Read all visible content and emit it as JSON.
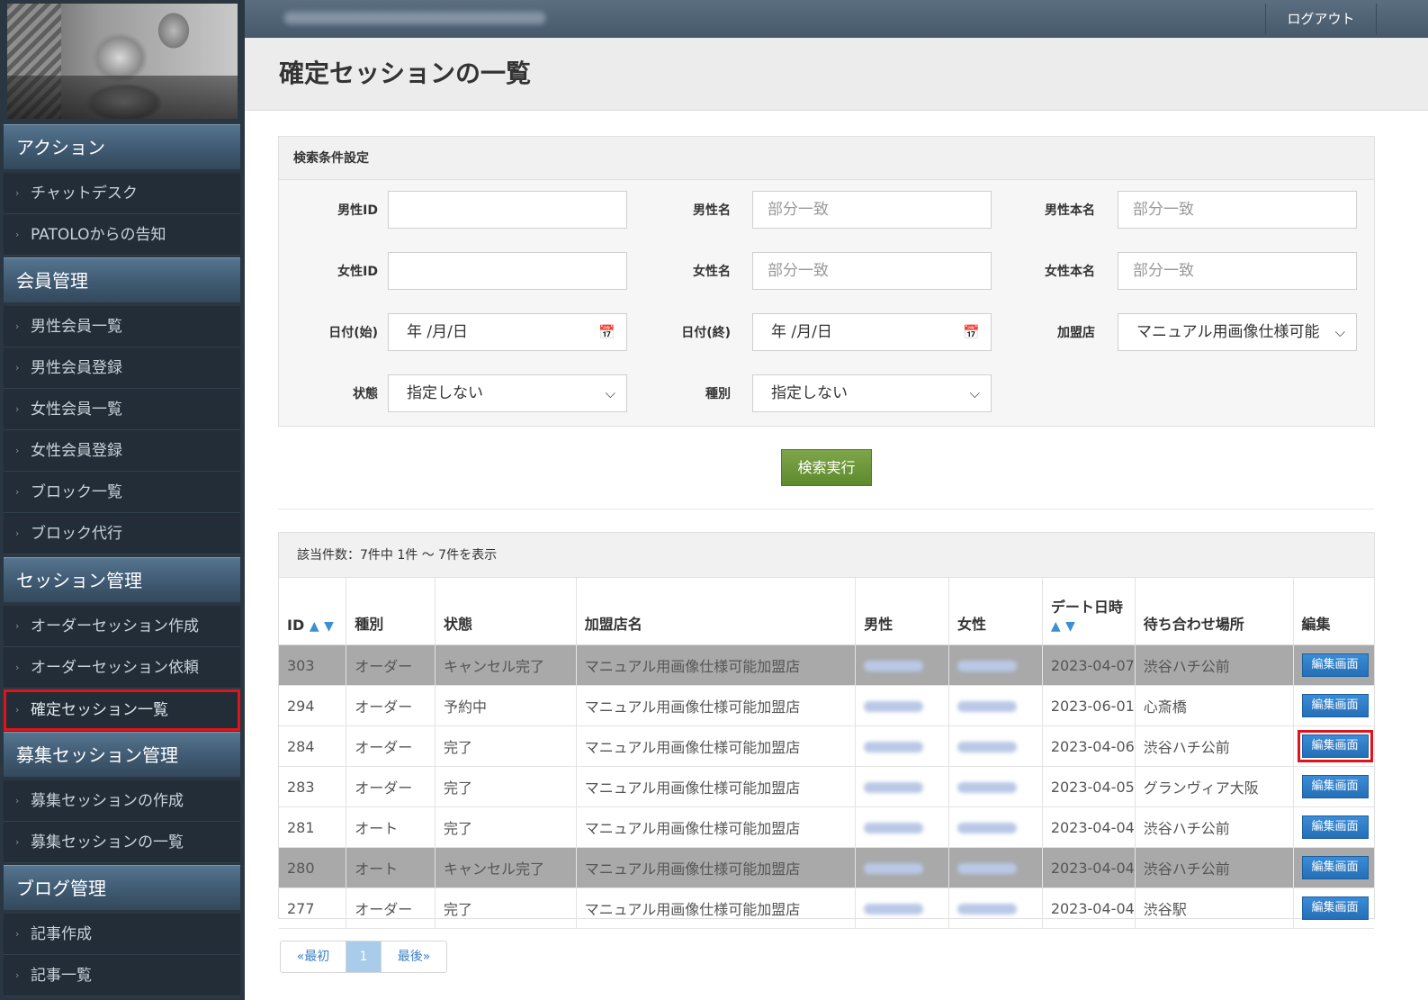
{
  "topbar": {
    "logout": "ログアウト"
  },
  "page": {
    "title": "確定セッションの一覧"
  },
  "sidebar": {
    "sections": [
      {
        "label": "アクション",
        "items": [
          "チャットデスク",
          "PATOLOからの告知"
        ]
      },
      {
        "label": "会員管理",
        "items": [
          "男性会員一覧",
          "男性会員登録",
          "女性会員一覧",
          "女性会員登録",
          "ブロック一覧",
          "ブロック代行"
        ]
      },
      {
        "label": "セッション管理",
        "items": [
          "オーダーセッション作成",
          "オーダーセッション依頼",
          "確定セッション一覧"
        ]
      },
      {
        "label": "募集セッション管理",
        "items": [
          "募集セッションの作成",
          "募集セッションの一覧"
        ]
      },
      {
        "label": "ブログ管理",
        "items": [
          "記事作成",
          "記事一覧"
        ]
      }
    ],
    "active_item": "確定セッション一覧"
  },
  "search": {
    "title": "検索条件設定",
    "male_id": {
      "label": "男性ID",
      "value": ""
    },
    "male_name": {
      "label": "男性名",
      "placeholder": "部分一致"
    },
    "male_real_name": {
      "label": "男性本名",
      "placeholder": "部分一致"
    },
    "female_id": {
      "label": "女性ID",
      "value": ""
    },
    "female_name": {
      "label": "女性名",
      "placeholder": "部分一致"
    },
    "female_real_name": {
      "label": "女性本名",
      "placeholder": "部分一致"
    },
    "date_start": {
      "label": "日付(始)",
      "value": "年 /月/日"
    },
    "date_end": {
      "label": "日付(終)",
      "value": "年 /月/日"
    },
    "store": {
      "label": "加盟店",
      "value": "マニュアル用画像仕様可能"
    },
    "status": {
      "label": "状態",
      "value": "指定しない"
    },
    "kind": {
      "label": "種別",
      "value": "指定しない"
    },
    "submit": "検索実行"
  },
  "results": {
    "summary": "該当件数：7件中 1件 ～ 7件を表示",
    "headers": {
      "id": "ID",
      "kind": "種別",
      "status": "状態",
      "store": "加盟店名",
      "male": "男性",
      "female": "女性",
      "date": "デート日時",
      "place": "待ち合わせ場所",
      "edit": "編集"
    },
    "sort_asc": "▲",
    "sort_desc": "▼",
    "edit_label": "編集画面",
    "rows": [
      {
        "id": "303",
        "kind": "オーダー",
        "status": "キャンセル完了",
        "store": "マニュアル用画像仕様可能加盟店",
        "date": "2023-04-07",
        "place": "渋谷ハチ公前",
        "cancelled": true
      },
      {
        "id": "294",
        "kind": "オーダー",
        "status": "予約中",
        "store": "マニュアル用画像仕様可能加盟店",
        "date": "2023-06-01",
        "place": "心斎橋",
        "cancelled": false
      },
      {
        "id": "284",
        "kind": "オーダー",
        "status": "完了",
        "store": "マニュアル用画像仕様可能加盟店",
        "date": "2023-04-06",
        "place": "渋谷ハチ公前",
        "cancelled": false,
        "highlight": true
      },
      {
        "id": "283",
        "kind": "オーダー",
        "status": "完了",
        "store": "マニュアル用画像仕様可能加盟店",
        "date": "2023-04-05",
        "place": "グランヴィア大阪",
        "cancelled": false
      },
      {
        "id": "281",
        "kind": "オート",
        "status": "完了",
        "store": "マニュアル用画像仕様可能加盟店",
        "date": "2023-04-04",
        "place": "渋谷ハチ公前",
        "cancelled": false
      },
      {
        "id": "280",
        "kind": "オート",
        "status": "キャンセル完了",
        "store": "マニュアル用画像仕様可能加盟店",
        "date": "2023-04-04",
        "place": "渋谷ハチ公前",
        "cancelled": true
      },
      {
        "id": "277",
        "kind": "オーダー",
        "status": "完了",
        "store": "マニュアル用画像仕様可能加盟店",
        "date": "2023-04-04",
        "place": "渋谷駅",
        "cancelled": false
      }
    ]
  },
  "pagination": {
    "first": "«最初",
    "current": "1",
    "last": "最後»"
  },
  "colors": {
    "accent_red": "#e0141b",
    "edit_blue": "#2470b8",
    "search_green": "#6a9636",
    "sidebar": "#2a3642"
  },
  "icons": {
    "calendar": "calendar-icon",
    "dropdown": "chevron-down-icon",
    "nav": "chevron-right-icon"
  }
}
